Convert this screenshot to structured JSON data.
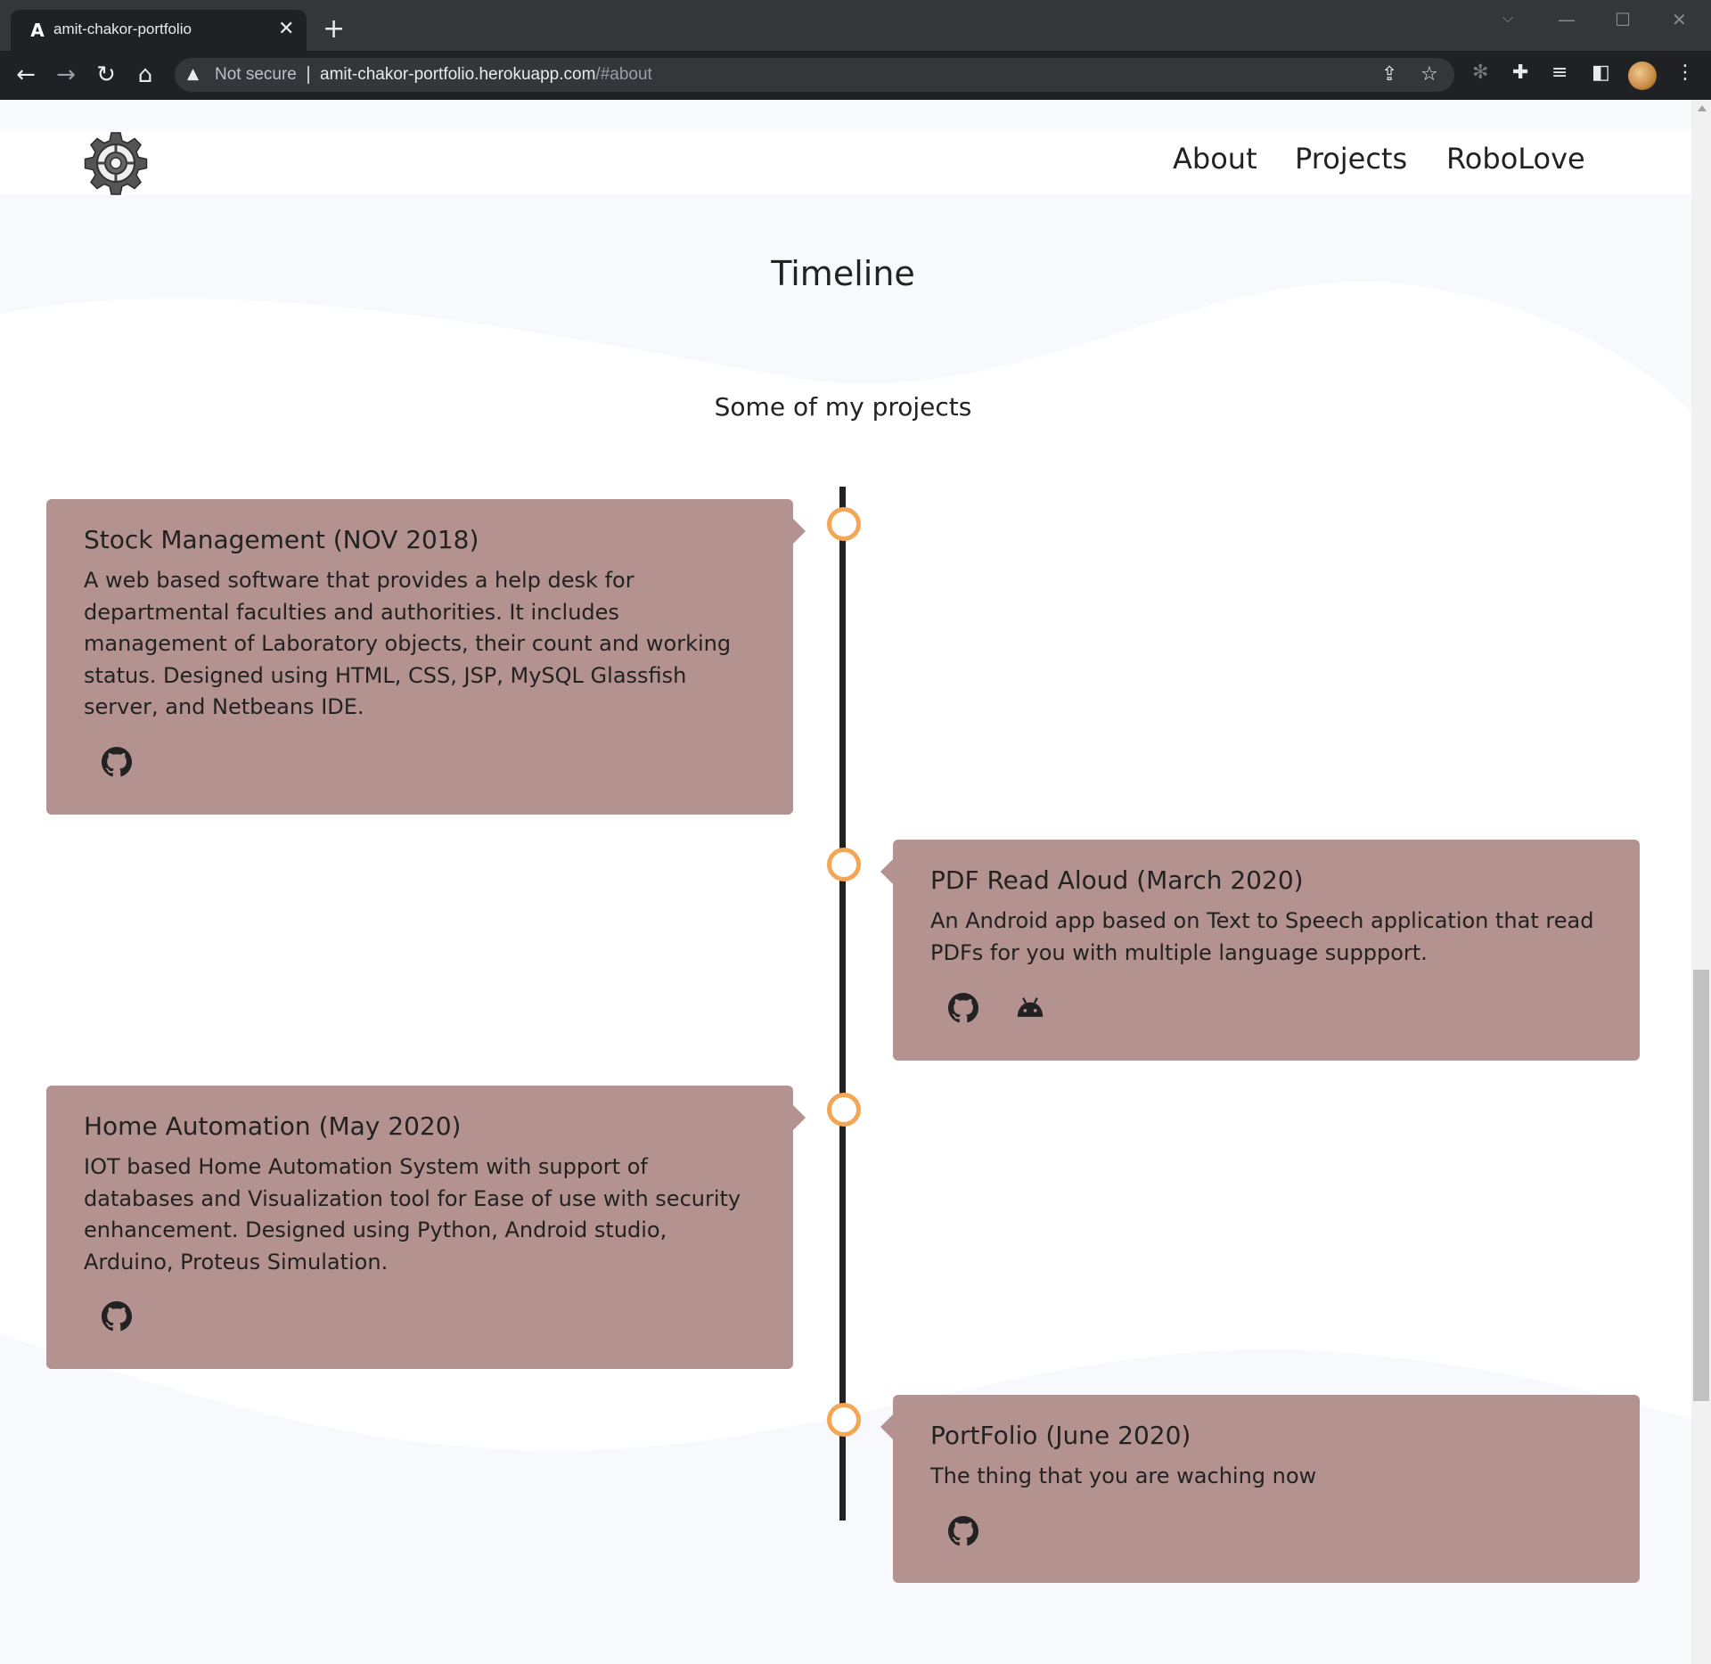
{
  "browser": {
    "tab_title": "amit-chakor-portfolio",
    "tab_favicon": "A",
    "security_label": "Not secure",
    "url_host": "amit-chakor-portfolio.herokuapp.com",
    "url_path": "/#about"
  },
  "nav": {
    "links": [
      {
        "label": "About"
      },
      {
        "label": "Projects"
      },
      {
        "label": "RoboLove"
      }
    ]
  },
  "timeline": {
    "title": "Timeline",
    "subtitle": "Some of my projects",
    "accent_color": "#f3a653",
    "card_color": "#b39290",
    "items": [
      {
        "title": "Stock Management (NOV 2018)",
        "description": "A web based software that provides a help desk for departmental faculties and authorities. It includes management of Laboratory objects, their count and working status. Designed using HTML, CSS, JSP, MySQL Glassfish server, and Netbeans IDE.",
        "icons": [
          "github-icon"
        ]
      },
      {
        "title": "PDF Read Aloud (March 2020)",
        "description": "An Android app based on Text to Speech application that read PDFs for you with multiple language suppport.",
        "icons": [
          "github-icon",
          "android-icon"
        ]
      },
      {
        "title": "Home Automation (May 2020)",
        "description": "IOT based Home Automation System with support of databases and Visualization tool for Ease of use with security enhancement. Designed using Python, Android studio, Arduino, Proteus Simulation.",
        "icons": [
          "github-icon"
        ]
      },
      {
        "title": "PortFolio (June 2020)",
        "description": "The thing that you are waching now",
        "icons": [
          "github-icon"
        ]
      }
    ]
  }
}
